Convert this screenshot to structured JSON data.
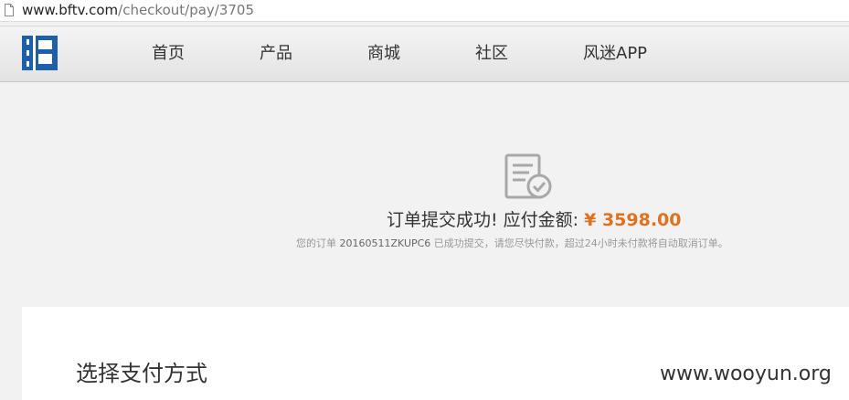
{
  "browser": {
    "url_host": "www.bftv.com",
    "url_path": "/checkout/pay/3705",
    "page_icon": "page-icon"
  },
  "header": {
    "logo": "bftv-logo",
    "nav": [
      {
        "label": "首页"
      },
      {
        "label": "产品"
      },
      {
        "label": "商城"
      },
      {
        "label": "社区"
      },
      {
        "label": "风迷APP"
      }
    ]
  },
  "order": {
    "icon": "order-check-icon",
    "title_prefix": "订单提交成功! 应付金额: ",
    "amount": "¥ 3598.00",
    "note_prefix": "您的订单 ",
    "order_no": "20160511ZKUPC6",
    "note_suffix": " 已成功提交，请您尽快付款，超过24小时未付款将自动取消订单。"
  },
  "payment": {
    "title": "选择支付方式"
  },
  "watermark": "www.wooyun.org",
  "colors": {
    "accent_amount": "#e2711d",
    "logo_blue": "#1d5fa8",
    "background": "#f2f2f2"
  }
}
